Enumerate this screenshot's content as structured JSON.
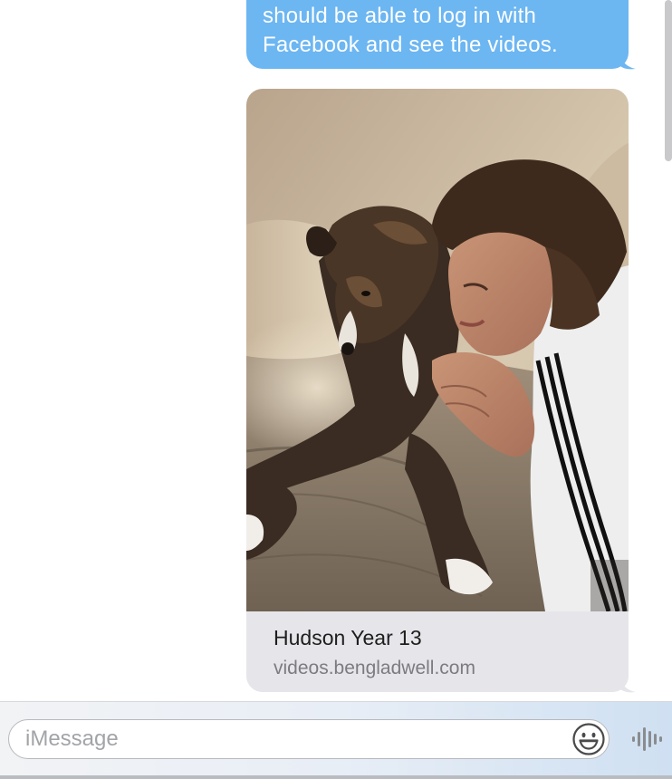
{
  "transcript": {
    "sent_message": {
      "lines": [
        "should be able to log in with",
        "Facebook and see the videos."
      ]
    },
    "link_preview": {
      "title": "Hudson Year 13",
      "url": "videos.bengladwell.com"
    }
  },
  "compose": {
    "placeholder": "iMessage",
    "emoji_icon": "emoji-smiley-icon",
    "audio_icon": "audio-waveform-icon"
  },
  "colors": {
    "sent_bubble": "#6cb6f2",
    "link_card_background": "#e6e6ea"
  }
}
